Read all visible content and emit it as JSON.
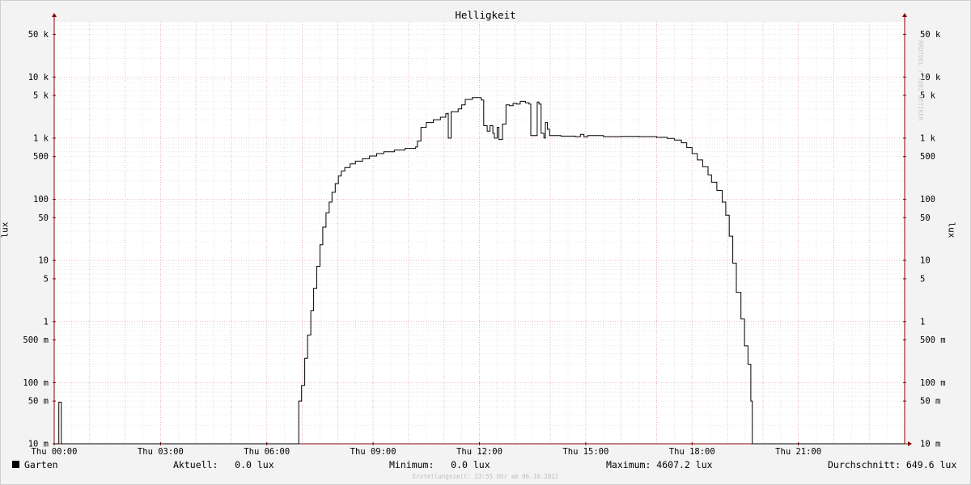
{
  "watermark": "RRDTOOL / TOBI OETIKER",
  "legend": {
    "series_name": "Garten",
    "current": "Aktuell:   0.0 lux",
    "minimum": "Minimum:   0.0 lux",
    "maximum": "Maximum: 4607.2 lux",
    "average": "Durchschnitt: 649.6 lux"
  },
  "footer": "Erstellungszeit: 23:55 Uhr am 06.10.2022",
  "colors": {
    "line": "#000000",
    "major_grid": "#e8a0a0",
    "minor_grid": "#d8d8d8",
    "axis": "#8a0000",
    "plot_bg": "#ffffff"
  },
  "chart_data": {
    "type": "line",
    "title": "Helligkeit",
    "ylabel": "lux",
    "xlabel": "",
    "y_scale": "log",
    "ylim": [
      0.01,
      80000
    ],
    "x_range_hours": [
      0,
      24
    ],
    "x_ticks": [
      {
        "h": 0,
        "label": "Thu 00:00"
      },
      {
        "h": 3,
        "label": "Thu 03:00"
      },
      {
        "h": 6,
        "label": "Thu 06:00"
      },
      {
        "h": 9,
        "label": "Thu 09:00"
      },
      {
        "h": 12,
        "label": "Thu 12:00"
      },
      {
        "h": 15,
        "label": "Thu 15:00"
      },
      {
        "h": 18,
        "label": "Thu 18:00"
      },
      {
        "h": 21,
        "label": "Thu 21:00"
      }
    ],
    "y_ticks": [
      {
        "v": 50000,
        "label": "50 k"
      },
      {
        "v": 10000,
        "label": "10 k"
      },
      {
        "v": 5000,
        "label": "5 k"
      },
      {
        "v": 1000,
        "label": "1 k"
      },
      {
        "v": 500,
        "label": "500"
      },
      {
        "v": 100,
        "label": "100"
      },
      {
        "v": 50,
        "label": "50"
      },
      {
        "v": 10,
        "label": "10"
      },
      {
        "v": 5,
        "label": "5"
      },
      {
        "v": 1,
        "label": "1"
      },
      {
        "v": 0.5,
        "label": "500 m"
      },
      {
        "v": 0.1,
        "label": "100 m"
      },
      {
        "v": 0.05,
        "label": "50 m"
      },
      {
        "v": 0.01,
        "label": "10 m"
      }
    ],
    "grid": true,
    "series": [
      {
        "name": "Garten",
        "points": [
          [
            0.0,
            0.0
          ],
          [
            0.13,
            0.0
          ],
          [
            0.13,
            0.048
          ],
          [
            0.2,
            0.048
          ],
          [
            0.2,
            0.0
          ],
          [
            6.9,
            0.0
          ],
          [
            6.9,
            0.05
          ],
          [
            6.98,
            0.09
          ],
          [
            7.07,
            0.25
          ],
          [
            7.15,
            0.6
          ],
          [
            7.24,
            1.5
          ],
          [
            7.32,
            3.5
          ],
          [
            7.41,
            8.0
          ],
          [
            7.5,
            18
          ],
          [
            7.58,
            35
          ],
          [
            7.67,
            60
          ],
          [
            7.76,
            90
          ],
          [
            7.84,
            130
          ],
          [
            7.93,
            180
          ],
          [
            8.02,
            240
          ],
          [
            8.1,
            290
          ],
          [
            8.2,
            330
          ],
          [
            8.35,
            380
          ],
          [
            8.5,
            420
          ],
          [
            8.7,
            460
          ],
          [
            8.9,
            510
          ],
          [
            9.1,
            560
          ],
          [
            9.3,
            600
          ],
          [
            9.6,
            640
          ],
          [
            9.9,
            680
          ],
          [
            10.2,
            720
          ],
          [
            10.25,
            900
          ],
          [
            10.35,
            1500
          ],
          [
            10.5,
            1800
          ],
          [
            10.7,
            2000
          ],
          [
            10.9,
            2200
          ],
          [
            11.05,
            2500
          ],
          [
            11.1,
            2550
          ],
          [
            11.12,
            1000
          ],
          [
            11.18,
            1000
          ],
          [
            11.2,
            2700
          ],
          [
            11.4,
            3000
          ],
          [
            11.5,
            3500
          ],
          [
            11.6,
            4300
          ],
          [
            11.8,
            4600
          ],
          [
            12.0,
            4600
          ],
          [
            12.05,
            4200
          ],
          [
            12.12,
            1600
          ],
          [
            12.22,
            1300
          ],
          [
            12.3,
            1600
          ],
          [
            12.38,
            1200
          ],
          [
            12.42,
            1000
          ],
          [
            12.5,
            1500
          ],
          [
            12.55,
            950
          ],
          [
            12.6,
            950
          ],
          [
            12.65,
            1700
          ],
          [
            12.75,
            3500
          ],
          [
            12.85,
            3400
          ],
          [
            12.95,
            3700
          ],
          [
            13.05,
            3600
          ],
          [
            13.15,
            4000
          ],
          [
            13.3,
            3800
          ],
          [
            13.4,
            3600
          ],
          [
            13.45,
            1100
          ],
          [
            13.58,
            1100
          ],
          [
            13.63,
            3900
          ],
          [
            13.68,
            3600
          ],
          [
            13.74,
            1200
          ],
          [
            13.82,
            1000
          ],
          [
            13.86,
            1800
          ],
          [
            13.92,
            1400
          ],
          [
            13.98,
            1100
          ],
          [
            14.3,
            1080
          ],
          [
            14.7,
            1060
          ],
          [
            14.85,
            1150
          ],
          [
            14.95,
            1050
          ],
          [
            15.05,
            1100
          ],
          [
            15.5,
            1060
          ],
          [
            16.0,
            1070
          ],
          [
            16.5,
            1060
          ],
          [
            17.0,
            1030
          ],
          [
            17.3,
            990
          ],
          [
            17.5,
            930
          ],
          [
            17.7,
            840
          ],
          [
            17.85,
            700
          ],
          [
            18.0,
            560
          ],
          [
            18.15,
            440
          ],
          [
            18.3,
            340
          ],
          [
            18.45,
            250
          ],
          [
            18.55,
            190
          ],
          [
            18.7,
            140
          ],
          [
            18.85,
            90
          ],
          [
            18.95,
            55
          ],
          [
            19.05,
            25
          ],
          [
            19.15,
            9
          ],
          [
            19.25,
            3
          ],
          [
            19.38,
            1.1
          ],
          [
            19.48,
            0.4
          ],
          [
            19.58,
            0.2
          ],
          [
            19.66,
            0.05
          ],
          [
            19.7,
            0.0
          ],
          [
            24.0,
            0.0
          ]
        ]
      }
    ]
  }
}
